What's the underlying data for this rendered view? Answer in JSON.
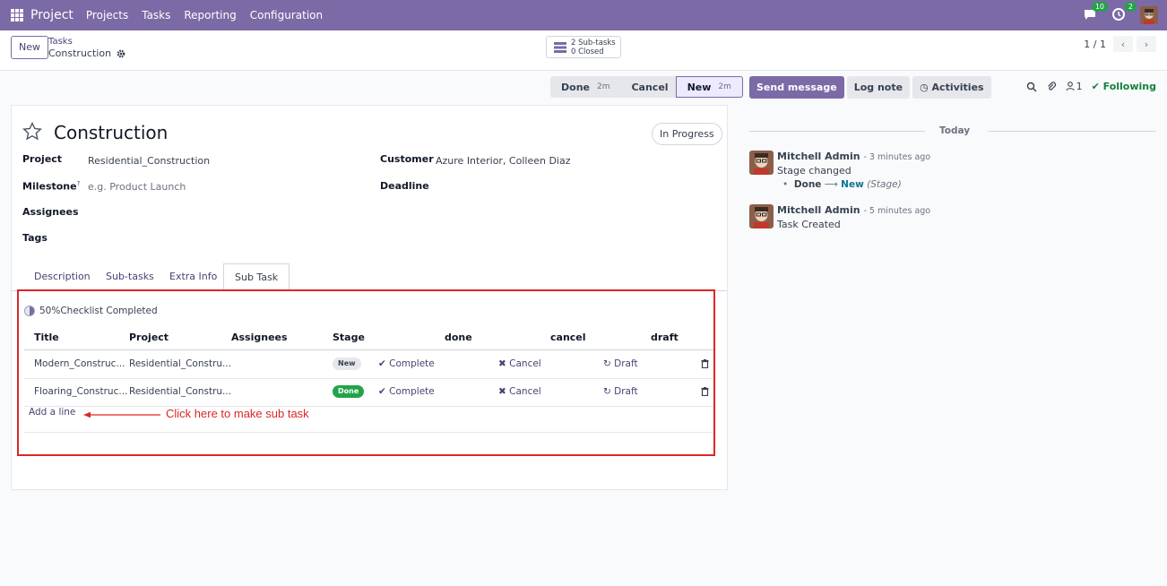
{
  "navbar": {
    "brand": "Project",
    "menu": [
      "Projects",
      "Tasks",
      "Reporting",
      "Configuration"
    ],
    "messages_badge": "10",
    "activities_badge": "2"
  },
  "control_panel": {
    "new_button": "New",
    "breadcrumb_parent": "Tasks",
    "breadcrumb_current": "Construction",
    "subtasks_line1": "2 Sub-tasks",
    "subtasks_line2": "0 Closed",
    "pager": "1 / 1"
  },
  "statusbar": {
    "stages": [
      {
        "label": "Done",
        "time": "2m"
      },
      {
        "label": "Cancel",
        "time": ""
      },
      {
        "label": "New",
        "time": "2m",
        "active": true
      }
    ]
  },
  "form": {
    "title": "Construction",
    "state_button": "In Progress",
    "fields": {
      "project_label": "Project",
      "project_value": "Residential_Construction",
      "milestone_label": "Milestone",
      "milestone_help": "?",
      "milestone_placeholder": "e.g. Product Launch",
      "assignees_label": "Assignees",
      "tags_label": "Tags",
      "customer_label": "Customer",
      "customer_value": "Azure Interior, Colleen Diaz",
      "deadline_label": "Deadline"
    },
    "tabs": [
      "Description",
      "Sub-tasks",
      "Extra Info",
      "Sub Task"
    ],
    "active_tab": "Sub Task"
  },
  "subtask": {
    "checklist_text": "50%Checklist Completed",
    "checklist_percent": 50,
    "columns": [
      "Title",
      "Project",
      "Assignees",
      "Stage",
      "done",
      "cancel",
      "draft"
    ],
    "rows": [
      {
        "title": "Modern_Construc...",
        "project": "Residential_Constru...",
        "assignees": "",
        "stage": "New",
        "done": "Complete",
        "cancel": "Cancel",
        "draft": "Draft"
      },
      {
        "title": "Floaring_Construc...",
        "project": "Residential_Constru...",
        "assignees": "",
        "stage": "Done",
        "done": "Complete",
        "cancel": "Cancel",
        "draft": "Draft"
      }
    ],
    "add_line": "Add a line",
    "annotation": "Click here to make sub task"
  },
  "chatter": {
    "send_message": "Send message",
    "log_note": "Log note",
    "activities": "Activities",
    "followers_count": "1",
    "following": "Following",
    "date_separator": "Today",
    "messages": [
      {
        "author": "Mitchell Admin",
        "time": "- 3 minutes ago",
        "body": "Stage changed",
        "tracking_old": "Done",
        "tracking_new": "New",
        "tracking_field": "(Stage)"
      },
      {
        "author": "Mitchell Admin",
        "time": "- 5 minutes ago",
        "body": "Task Created"
      }
    ]
  },
  "colors": {
    "brand": "#7b6aa5",
    "success": "#22a34a",
    "annotation": "#dc2626"
  }
}
